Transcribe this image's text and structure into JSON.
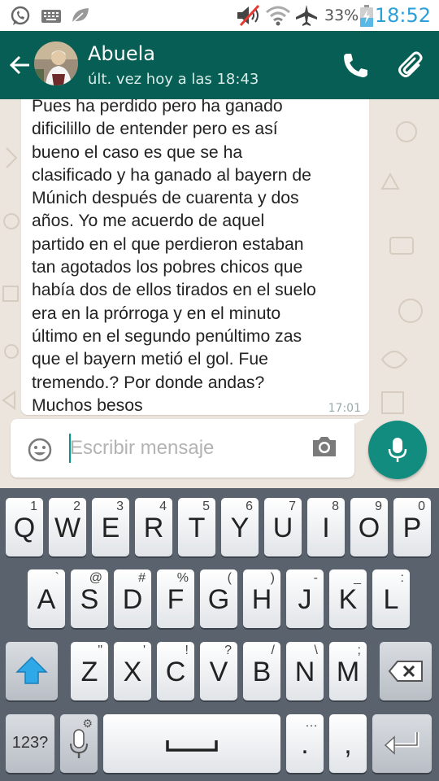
{
  "status_bar": {
    "battery_percent": "33%",
    "time": "18:52",
    "icons": [
      "whatsapp-icon",
      "keyboard-icon",
      "leaf-icon",
      "mute-icon",
      "wifi-icon",
      "airplane-icon",
      "battery-icon"
    ]
  },
  "header": {
    "contact_name": "Abuela",
    "last_seen": "últ. vez hoy a las 18:43",
    "icons": [
      "back-arrow-icon",
      "avatar",
      "phone-icon",
      "paperclip-icon"
    ]
  },
  "chat": {
    "message_lines": [
      "Pues ha perdido pero ha ganado",
      "dificilillo de entender pero es así",
      "bueno el caso es que se ha",
      "clasificado y ha ganado al bayern de",
      "Múnich después de cuarenta y dos",
      "años. Yo me acuerdo de aquel",
      "partido en el que perdieron estaban",
      "tan agotados los pobres chicos que",
      "había dos de ellos tirados en el suelo",
      "era en la prórroga y en el minuto",
      "último en el segundo penúltimo zas",
      "que el bayern metió el gol. Fue",
      "tremendo.? Por donde andas?",
      "Muchos besos"
    ],
    "message_time": "17:01"
  },
  "composer": {
    "placeholder": "Escribir mensaje",
    "value": "",
    "icons": [
      "emoji-icon",
      "camera-icon",
      "microphone-icon"
    ]
  },
  "keyboard": {
    "row1": [
      {
        "main": "Q",
        "hint": "1"
      },
      {
        "main": "W",
        "hint": "2"
      },
      {
        "main": "E",
        "hint": "3"
      },
      {
        "main": "R",
        "hint": "4"
      },
      {
        "main": "T",
        "hint": "5"
      },
      {
        "main": "Y",
        "hint": "6"
      },
      {
        "main": "U",
        "hint": "7"
      },
      {
        "main": "I",
        "hint": "8"
      },
      {
        "main": "O",
        "hint": "9"
      },
      {
        "main": "P",
        "hint": "0"
      }
    ],
    "row2": [
      {
        "main": "A",
        "hint": "`"
      },
      {
        "main": "S",
        "hint": "@"
      },
      {
        "main": "D",
        "hint": "#"
      },
      {
        "main": "F",
        "hint": "%"
      },
      {
        "main": "G",
        "hint": "("
      },
      {
        "main": "H",
        "hint": ")"
      },
      {
        "main": "J",
        "hint": "-"
      },
      {
        "main": "K",
        "hint": "_"
      },
      {
        "main": "L",
        "hint": ":"
      }
    ],
    "row3": [
      {
        "main": "Z",
        "hint": "\""
      },
      {
        "main": "X",
        "hint": "'"
      },
      {
        "main": "C",
        "hint": "!"
      },
      {
        "main": "V",
        "hint": "?"
      },
      {
        "main": "B",
        "hint": "/"
      },
      {
        "main": "N",
        "hint": "\\"
      },
      {
        "main": "M",
        "hint": ";"
      }
    ],
    "symbols_label": "123?",
    "period_label": ".",
    "period_hint": "…",
    "comma_label": ",",
    "icons": [
      "shift-icon",
      "backspace-icon",
      "mic-icon",
      "space-icon",
      "enter-icon"
    ]
  },
  "colors": {
    "header_bg": "#075e54",
    "accent": "#128c7e",
    "clock_blue": "#2b9fd6",
    "keyboard_bg": "#59626d"
  }
}
